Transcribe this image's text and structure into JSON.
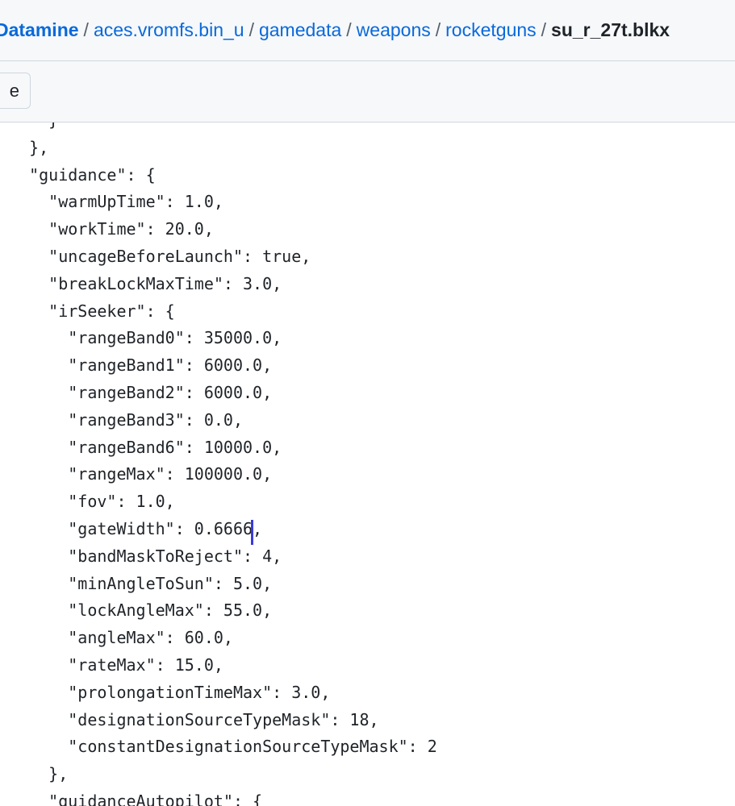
{
  "breadcrumb": {
    "root": "Datamine",
    "separator": "/",
    "items": [
      "aces.vromfs.bin_u",
      "gamedata",
      "weapons",
      "rocketguns"
    ],
    "current": "su_r_27t.blkx"
  },
  "toolbar": {
    "button_label": "e"
  },
  "code": {
    "lines": [
      "    }",
      "  },",
      "  \"guidance\": {",
      "    \"warmUpTime\": 1.0,",
      "    \"workTime\": 20.0,",
      "    \"uncageBeforeLaunch\": true,",
      "    \"breakLockMaxTime\": 3.0,",
      "    \"irSeeker\": {",
      "      \"rangeBand0\": 35000.0,",
      "      \"rangeBand1\": 6000.0,",
      "      \"rangeBand2\": 6000.0,",
      "      \"rangeBand3\": 0.0,",
      "      \"rangeBand6\": 10000.0,",
      "      \"rangeMax\": 100000.0,",
      "      \"fov\": 1.0,",
      "      \"gateWidth\": 0.6666,",
      "      \"bandMaskToReject\": 4,",
      "      \"minAngleToSun\": 5.0,",
      "      \"lockAngleMax\": 55.0,",
      "      \"angleMax\": 60.0,",
      "      \"rateMax\": 15.0,",
      "      \"prolongationTimeMax\": 3.0,",
      "      \"designationSourceTypeMask\": 18,",
      "      \"constantDesignationSourceTypeMask\": 2",
      "    },",
      "    \"guidanceAutopilot\": {"
    ]
  }
}
